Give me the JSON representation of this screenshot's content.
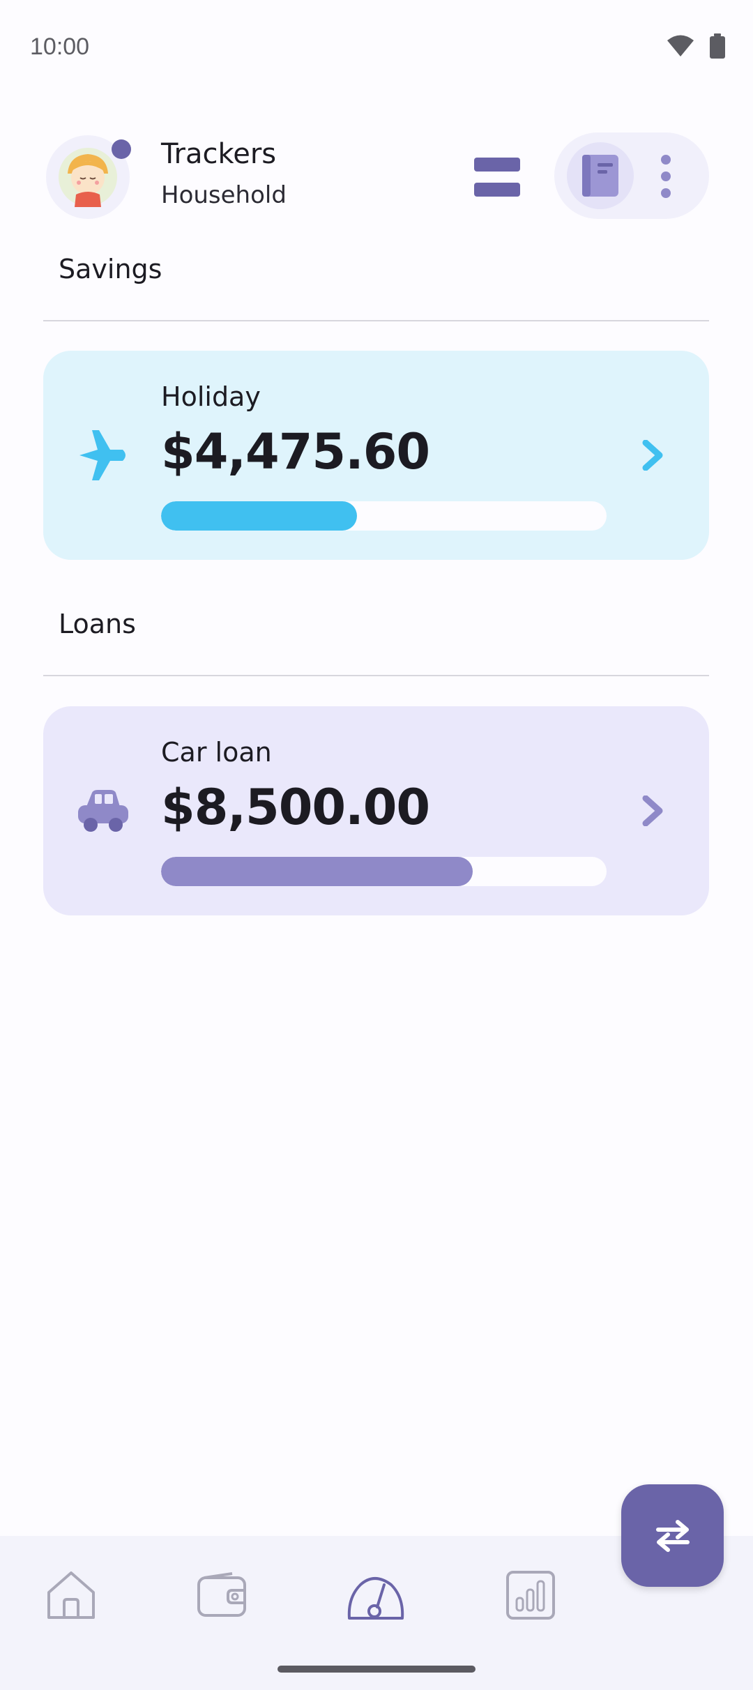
{
  "status_bar": {
    "time": "10:00",
    "icons": [
      "wifi-icon",
      "battery-icon"
    ]
  },
  "header": {
    "title": "Trackers",
    "subtitle": "Household",
    "avatar": "avatar-icon",
    "notification_dot_color": "#6a64a8",
    "menu_icon": "menu-icon",
    "book_icon": "book-icon",
    "more_icon": "more-vert-icon"
  },
  "sections": {
    "savings": {
      "title": "Savings",
      "cards": [
        {
          "name": "Holiday",
          "amount": "$4,475.60",
          "icon": "airplane-icon",
          "progress": 0.44,
          "accent": "#40c0f0",
          "background": "#dff4fc"
        }
      ]
    },
    "loans": {
      "title": "Loans",
      "cards": [
        {
          "name": "Car loan",
          "amount": "$8,500.00",
          "icon": "car-icon",
          "progress": 0.7,
          "accent": "#8f89c8",
          "background": "#eae8fb"
        }
      ]
    }
  },
  "fab": {
    "icon": "swap-icon",
    "color": "#6a64a8"
  },
  "bottom_nav": {
    "items": [
      {
        "icon": "home-icon",
        "active": false
      },
      {
        "icon": "wallet-icon",
        "active": false
      },
      {
        "icon": "gauge-icon",
        "active": true
      },
      {
        "icon": "chart-icon",
        "active": false
      }
    ]
  }
}
